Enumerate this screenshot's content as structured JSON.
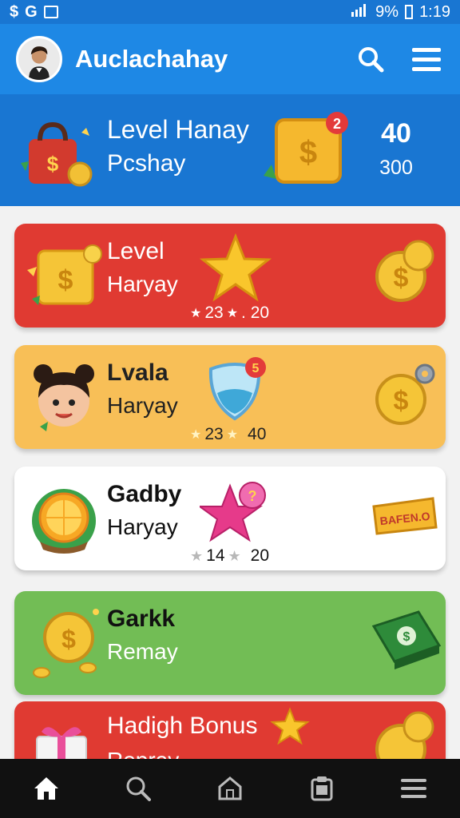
{
  "status_bar": {
    "left_icons": [
      "$",
      "G"
    ],
    "battery": "9%",
    "time": "1:19"
  },
  "header": {
    "title": "Auclachahay",
    "search_icon": "search-icon",
    "menu_icon": "menu-icon"
  },
  "level_banner": {
    "title": "Level Hanay",
    "subtitle": "Pcshay",
    "badge": "2",
    "value1": "40",
    "value2": "300"
  },
  "cards": [
    {
      "title": "Level",
      "subtitle": "Haryay",
      "stat_a": "23",
      "stat_b": ". 20",
      "color": "#e03a32"
    },
    {
      "title": "Lvala",
      "subtitle": "Haryay",
      "stat_a": "23",
      "stat_b": "40",
      "badge": "5",
      "color": "#f8bf57"
    },
    {
      "title": "Gadby",
      "subtitle": "Haryay",
      "stat_a": "14",
      "stat_b": "20",
      "right_label": "BAFEN.O",
      "color": "#ffffff"
    },
    {
      "title": "Garkk",
      "subtitle": "Remay",
      "color": "#72bd55"
    },
    {
      "title": "Hadigh Bonus",
      "subtitle": "Ropray",
      "color": "#e03a32"
    }
  ],
  "bottom_nav": [
    "home-icon",
    "search-icon",
    "house-icon",
    "clipboard-icon",
    "menu-icon"
  ]
}
